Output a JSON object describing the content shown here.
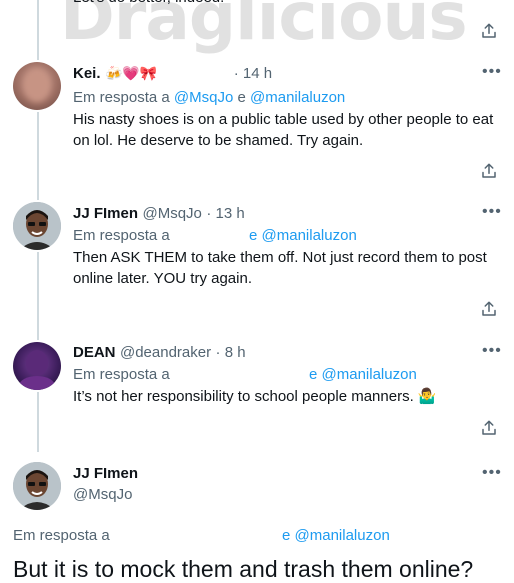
{
  "watermark": "Draglicious",
  "top_partial_text": "Let's do better, indeed.",
  "tweets": [
    {
      "name": "Kei.",
      "emoji": "🍻💗🎀",
      "handle": "",
      "time": "· 14 h",
      "reply_prefix": "Em resposta a",
      "reply_to_1": "@MsqJo",
      "reply_and": "e",
      "reply_to_2": "@manilaluzon",
      "text": "His nasty shoes is on a public table used by other people to eat on lol. He deserve to be shamed. Try again."
    },
    {
      "name": "JJ FImen",
      "handle": "@MsqJo",
      "time": "· 13 h",
      "reply_prefix": "Em resposta a",
      "reply_to_2": "e @manilaluzon",
      "text": "Then ASK THEM to take them off. Not just record them to post online later. YOU try again."
    },
    {
      "name": "DEAN",
      "handle": "@deandraker",
      "time": "· 8 h",
      "reply_prefix": "Em resposta a",
      "reply_to_2": "e @manilaluzon",
      "text": "It’s not her responsibility to school people manners.",
      "emoji": "🤷‍♂️"
    }
  ],
  "main_tweet": {
    "name": "JJ FImen",
    "handle": "@MsqJo",
    "reply_prefix": "Em resposta a",
    "reply_to_2": "e @manilaluzon",
    "text": "But it is to mock them and trash them online?"
  },
  "icons": {
    "more": "more-horizontal-icon",
    "share": "share-icon"
  }
}
